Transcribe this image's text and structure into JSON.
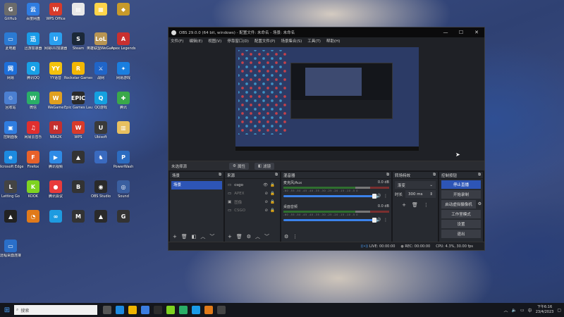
{
  "desktop_icons": [
    {
      "label": "GitHub",
      "color": "#6b6b6b",
      "glyph": "G"
    },
    {
      "label": "百度网盘",
      "color": "#2f7de1",
      "glyph": "云"
    },
    {
      "label": "WPS Office",
      "color": "#d83b2b",
      "glyph": "W"
    },
    {
      "label": "",
      "color": "#e8e8e8",
      "glyph": "▤"
    },
    {
      "label": "",
      "color": "#ffd54a",
      "glyph": "▦"
    },
    {
      "label": "",
      "color": "#c79a2a",
      "glyph": "◆"
    },
    {
      "label": "此电脑",
      "color": "#2b7ad3",
      "glyph": "▭"
    },
    {
      "label": "迅游加速器",
      "color": "#1a9be8",
      "glyph": "迅"
    },
    {
      "label": "网易UU加速器",
      "color": "#2aa0f0",
      "glyph": "U"
    },
    {
      "label": "Steam",
      "color": "#1b2838",
      "glyph": "S"
    },
    {
      "label": "英雄联盟WeGame版",
      "color": "#b89553",
      "glyph": "LoL"
    },
    {
      "label": "Apex Legends",
      "color": "#c93030",
      "glyph": "A"
    },
    {
      "label": "网易",
      "color": "#1e6fd9",
      "glyph": "网"
    },
    {
      "label": "腾讯QQ",
      "color": "#18a0e6",
      "glyph": "Q"
    },
    {
      "label": "YY语音",
      "color": "#f4c20d",
      "glyph": "YY"
    },
    {
      "label": "Rockstar Games",
      "color": "#f2b705",
      "glyph": "R"
    },
    {
      "label": "战网",
      "color": "#2065c8",
      "glyph": "⚔"
    },
    {
      "label": "网易游戏",
      "color": "#1a7fe0",
      "glyph": "✦"
    },
    {
      "label": "回收站",
      "color": "#4b7fd1",
      "glyph": "♲"
    },
    {
      "label": "微信",
      "color": "#2aae67",
      "glyph": "W"
    },
    {
      "label": "WeGame",
      "color": "#e0a020",
      "glyph": "W"
    },
    {
      "label": "Epic Games Launcher",
      "color": "#2a2a2a",
      "glyph": "EPIC"
    },
    {
      "label": "QQ游戏",
      "color": "#15a0e0",
      "glyph": "Q"
    },
    {
      "label": "腾讯",
      "color": "#3aa84a",
      "glyph": "✚"
    },
    {
      "label": "控制面板",
      "color": "#2f7de1",
      "glyph": "▣"
    },
    {
      "label": "网易云音乐",
      "color": "#e02f2f",
      "glyph": "♫"
    },
    {
      "label": "NBA2K",
      "color": "#c42f2f",
      "glyph": "N"
    },
    {
      "label": "WPS",
      "color": "#d83b2b",
      "glyph": "W"
    },
    {
      "label": "Ubisoft",
      "color": "#3a3a3a",
      "glyph": "U"
    },
    {
      "label": "",
      "color": "#e8c060",
      "glyph": "▥"
    },
    {
      "label": "Microsoft Edge",
      "color": "#1d8ae0",
      "glyph": "e"
    },
    {
      "label": "Firefox",
      "color": "#e8612a",
      "glyph": "F"
    },
    {
      "label": "腾讯视频",
      "color": "#2f8be6",
      "glyph": "▶"
    },
    {
      "label": "",
      "color": "#333",
      "glyph": "▲"
    },
    {
      "label": "",
      "color": "#3a6abf",
      "glyph": "♞"
    },
    {
      "label": "PowerWash",
      "color": "#2c6cc0",
      "glyph": "P"
    },
    {
      "label": "Letting Go",
      "color": "#444",
      "glyph": "L"
    },
    {
      "label": "KOOK",
      "color": "#7ed321",
      "glyph": "K"
    },
    {
      "label": "腾讯会议",
      "color": "#e83b3b",
      "glyph": "●"
    },
    {
      "label": "",
      "color": "#333",
      "glyph": "B"
    },
    {
      "label": "OBS Studio",
      "color": "#2a2a2a",
      "glyph": "◉"
    },
    {
      "label": "Sound",
      "color": "#3a5fa0",
      "glyph": "◎"
    },
    {
      "label": "",
      "color": "#222",
      "glyph": "▲"
    },
    {
      "label": "",
      "color": "#e07a1a",
      "glyph": "◔"
    },
    {
      "label": "",
      "color": "#1e9be0",
      "glyph": "∞"
    },
    {
      "label": "",
      "color": "#333",
      "glyph": "M"
    },
    {
      "label": "",
      "color": "#2a2a2a",
      "glyph": "▲"
    },
    {
      "label": "",
      "color": "#333",
      "glyph": "G"
    },
    {
      "label": "远程桌面连接",
      "color": "#2a6fc9",
      "glyph": "▭"
    }
  ],
  "obs": {
    "title": "OBS 29.0.0 (64 bit, windows) - 配置文件: 未命名 - 场景: 未命名",
    "menu": [
      "文件(F)",
      "编辑(E)",
      "视图(V)",
      "停靠窗口(D)",
      "配置文件(P)",
      "场景集合(S)",
      "工具(T)",
      "帮助(H)"
    ],
    "source_bar": {
      "label": "未选择源",
      "properties": "属性",
      "filters": "滤镜"
    },
    "docks": {
      "scenes": {
        "title": "场景",
        "items": [
          "场景"
        ]
      },
      "sources": {
        "title": "来源",
        "items": [
          "csgo",
          "APEX",
          "图像",
          "CSGO"
        ]
      },
      "mixer": {
        "title": "混音器",
        "channels": [
          {
            "name": "麦克风/Aux",
            "db": "0.0 dB"
          },
          {
            "name": "桌面音频",
            "db": "0.0 dB"
          }
        ],
        "ticks": "-60 -55 -50 -45 -40 -35 -30 -25 -20 -15 -10 -5 0"
      },
      "transitions": {
        "title": "转场特效",
        "type": "渐变",
        "duration_label": "时长",
        "duration": "300 ms"
      },
      "controls": {
        "title": "控制按钮",
        "buttons": [
          "停止直播",
          "开始录制",
          "启动虚拟摄像机",
          "工作室模式",
          "设置",
          "退出"
        ]
      }
    },
    "status": {
      "live": "LIVE: 00:00:00",
      "rec": "REC: 00:00:00",
      "cpu": "CPU: 4.3%, 30.00 fps"
    }
  },
  "taskbar": {
    "search_placeholder": "搜索",
    "time": "下午6:16",
    "date": "23/4/2023"
  }
}
